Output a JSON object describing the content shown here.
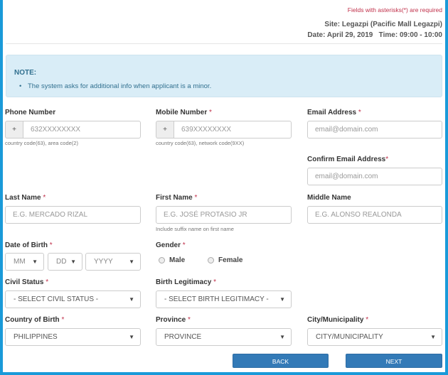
{
  "header": {
    "required_note": "Fields with asterisks(*) are required",
    "site_label": "Site:",
    "site_value": "Legazpi (Pacific Mall Legazpi)",
    "date_label": "Date:",
    "date_value": "April 29, 2019",
    "time_label": "Time:",
    "time_value": "09:00 - 10:00"
  },
  "note": {
    "title": "NOTE:",
    "items": [
      "The system asks for additional info when applicant is a minor."
    ]
  },
  "required_mark": "*",
  "form": {
    "phone": {
      "label": "Phone Number",
      "addon": "+",
      "placeholder": "632XXXXXXXX",
      "help": "country code(63), area code(2)"
    },
    "mobile": {
      "label": "Mobile Number",
      "addon": "+",
      "placeholder": "639XXXXXXXX",
      "help": "country code(63), network code(9XX)"
    },
    "email": {
      "label": "Email Address",
      "placeholder": "email@domain.com"
    },
    "confirm_email": {
      "label": "Confirm Email Address",
      "placeholder": "email@domain.com"
    },
    "last_name": {
      "label": "Last Name",
      "placeholder": "E.G. MERCADO RIZAL"
    },
    "first_name": {
      "label": "First Name",
      "placeholder": "E.G. JOSÉ PROTASIO JR",
      "help": "Include suffix name on first name"
    },
    "middle_name": {
      "label": "Middle Name",
      "placeholder": "E.G. ALONSO REALONDA"
    },
    "dob": {
      "label": "Date of Birth",
      "month": "MM",
      "day": "DD",
      "year": "YYYY"
    },
    "gender": {
      "label": "Gender",
      "options": [
        "Male",
        "Female"
      ]
    },
    "civil_status": {
      "label": "Civil Status",
      "value": "- SELECT CIVIL STATUS -"
    },
    "birth_legitimacy": {
      "label": "Birth Legitimacy",
      "value": "- SELECT BIRTH LEGITIMACY -"
    },
    "country_of_birth": {
      "label": "Country of Birth",
      "value": "PHILIPPINES"
    },
    "province": {
      "label": "Province",
      "value": "PROVINCE"
    },
    "city": {
      "label": "City/Municipality",
      "value": "CITY/MUNICIPALITY"
    }
  },
  "buttons": {
    "back": "BACK",
    "next": "NEXT"
  },
  "icons": {
    "caret": "▼"
  },
  "colors": {
    "frame": "#1a9ad9",
    "primary": "#337ab7",
    "note_bg": "#d9edf7",
    "required": "#c0304a"
  }
}
